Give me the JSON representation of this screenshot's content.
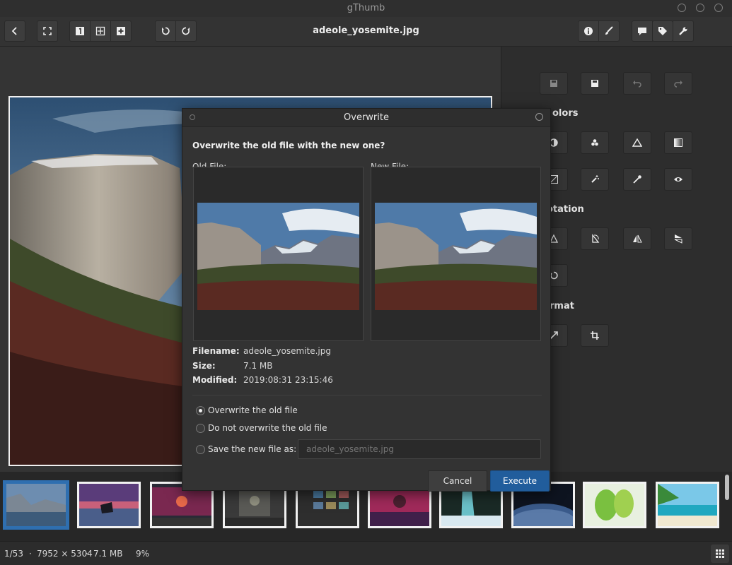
{
  "window": {
    "title": "gThumb"
  },
  "toolbar": {
    "file_title": "adeole_yosemite.jpg"
  },
  "side_panel": {
    "sections": [
      {
        "label": "olors"
      },
      {
        "label": "otation"
      },
      {
        "label": "rmat"
      }
    ]
  },
  "dialog": {
    "title": "Overwrite",
    "question": "Overwrite the old file with the new one?",
    "old_label": "Old File:",
    "new_label": "New File:",
    "info": {
      "filename_key": "Filename:",
      "filename": "adeole_yosemite.jpg",
      "size_key": "Size:",
      "size": "7.1 MB",
      "modified_key": "Modified:",
      "modified": "2019:08:31 23:15:46"
    },
    "options": [
      {
        "label": "Overwrite the old file",
        "selected": true
      },
      {
        "label": "Do not overwrite the old file",
        "selected": false
      },
      {
        "label": "Save the new file as:",
        "selected": false
      }
    ],
    "saveas_placeholder": "adeole_yosemite.jpg",
    "cancel_label": "Cancel",
    "execute_label": "Execute"
  },
  "status": {
    "position": "1/53",
    "dimensions": "7952 × 5304",
    "size": "7.1 MB",
    "zoom": "9%"
  },
  "colors": {
    "accent": "#215d9c",
    "selection": "#2f6fb0"
  }
}
